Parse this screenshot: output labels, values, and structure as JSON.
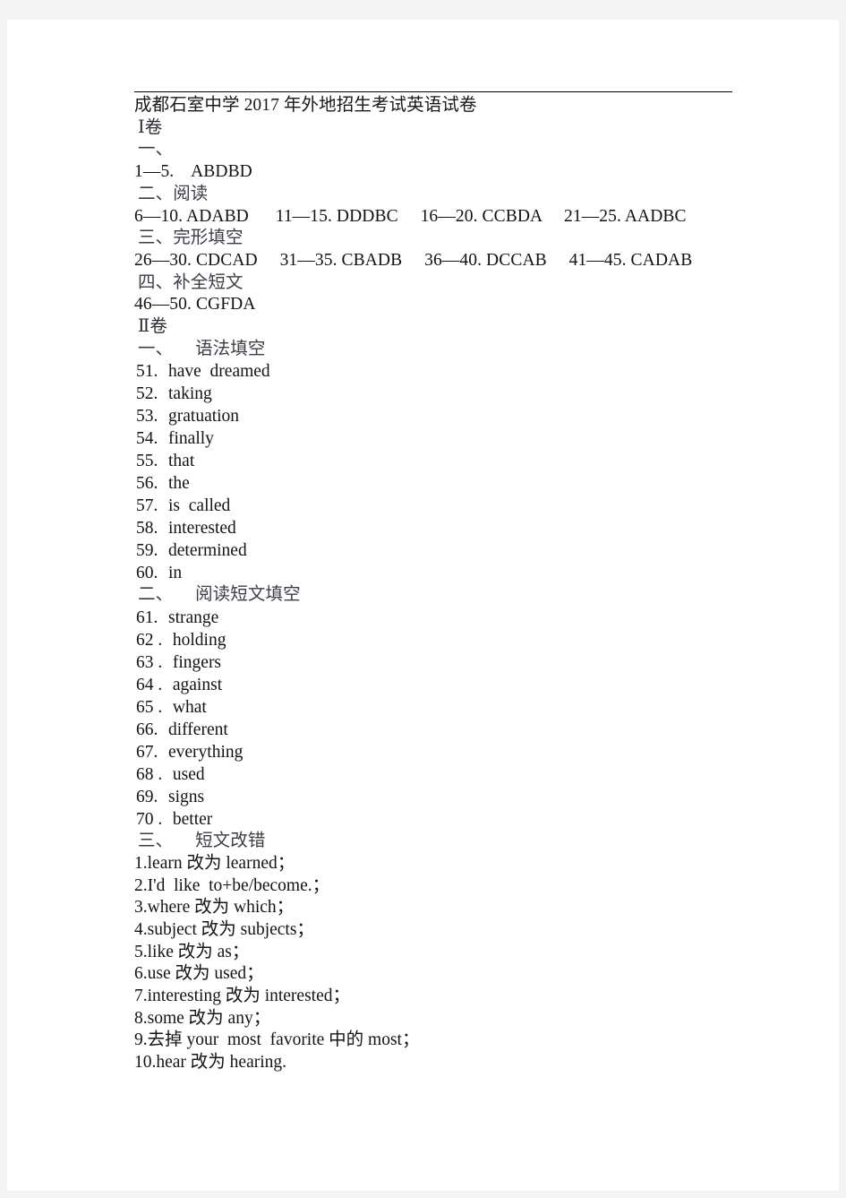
{
  "document": {
    "title": "成都石室中学 2017 年外地招生考试英语试卷",
    "paper_one_label": "Ⅰ卷",
    "paper_two_label": "Ⅱ卷"
  },
  "paper_one": {
    "sections": [
      {
        "heading": "一、",
        "answers": "1—5.    ABDBD"
      },
      {
        "heading": "二、阅读",
        "answers": "6—10. ADABD      11—15. DDDBC     16—20. CCBDA     21—25. AADBC"
      },
      {
        "heading": "三、完形填空",
        "answers": "26—30. CDCAD     31—35. CBADB     36—40. DCCAB     41—45. CADAB"
      },
      {
        "heading": "四、补全短文",
        "answers": "46—50. CGFDA"
      }
    ]
  },
  "paper_two": {
    "grammar_fill": {
      "heading": "一、     语法填空",
      "items": [
        {
          "index": "51.",
          "answer": "have  dreamed"
        },
        {
          "index": "52.",
          "answer": "taking"
        },
        {
          "index": "53.",
          "answer": "gratuation"
        },
        {
          "index": "54.",
          "answer": "finally"
        },
        {
          "index": "55.",
          "answer": "that"
        },
        {
          "index": "56.",
          "answer": "the"
        },
        {
          "index": "57.",
          "answer": "is  called"
        },
        {
          "index": "58.",
          "answer": "interested"
        },
        {
          "index": "59.",
          "answer": "determined"
        },
        {
          "index": "60.",
          "answer": "in"
        }
      ]
    },
    "reading_fill": {
      "heading": "二、     阅读短文填空",
      "items": [
        {
          "index": "61.",
          "answer": "strange"
        },
        {
          "index": "62 .",
          "answer": " holding"
        },
        {
          "index": "63 .",
          "answer": " fingers"
        },
        {
          "index": "64 .",
          "answer": " against"
        },
        {
          "index": "65 .",
          "answer": " what"
        },
        {
          "index": "66.",
          "answer": "different"
        },
        {
          "index": "67.",
          "answer": "everything"
        },
        {
          "index": "68 .",
          "answer": " used"
        },
        {
          "index": "69.",
          "answer": "signs"
        },
        {
          "index": "70 .",
          "answer": " better"
        }
      ]
    },
    "error_correction": {
      "heading": "三、     短文改错",
      "items": [
        "1.learn 改为 learned；",
        "2.I'd  like  to+be/become.；",
        "3.where 改为 which；",
        "4.subject 改为 subjects；",
        "5.like 改为 as；",
        "6.use 改为 used；",
        "7.interesting 改为 interested；",
        "8.some 改为 any；",
        "9.去掉 your  most  favorite 中的 most；",
        "10.hear 改为 hearing."
      ]
    }
  }
}
